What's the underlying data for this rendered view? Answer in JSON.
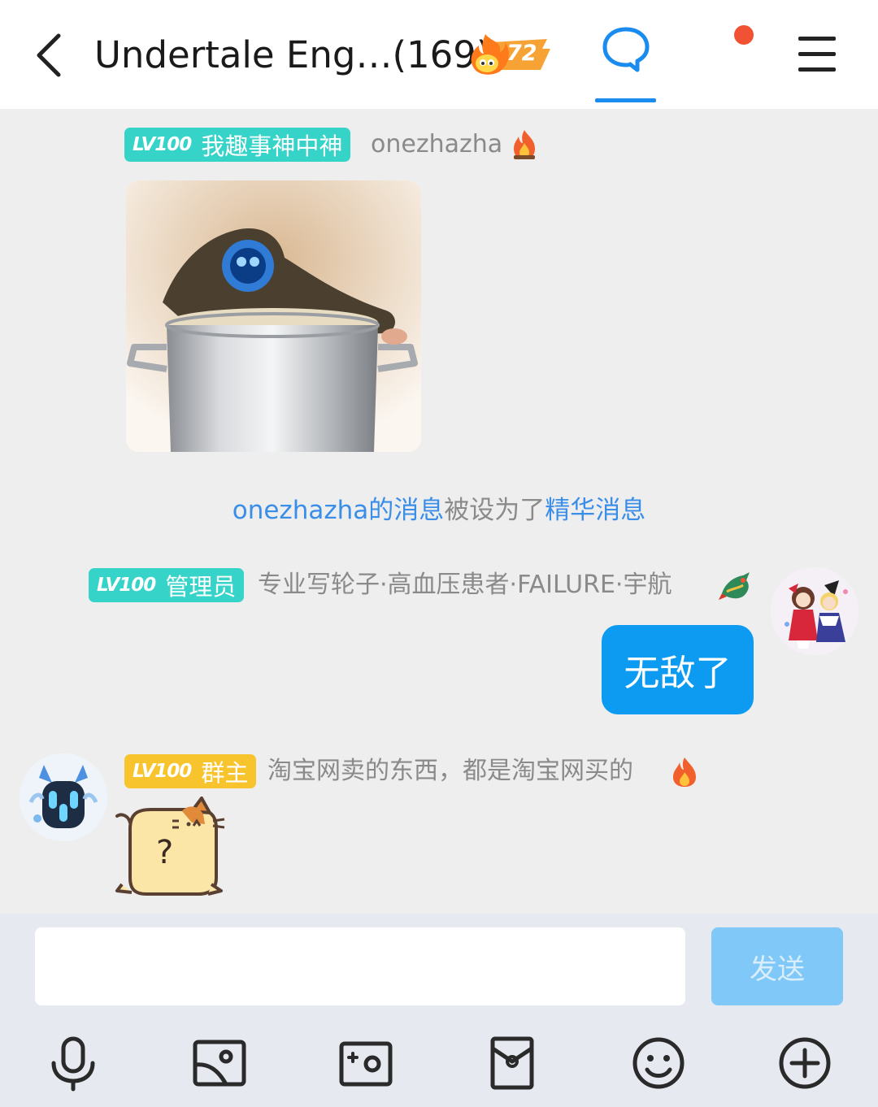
{
  "header": {
    "title": "Undertale Eng…(169)",
    "fire_level": "72"
  },
  "messages": {
    "first": {
      "level": "LV100",
      "title": "我趣事神中神",
      "nickname": "onezhazha"
    },
    "system_notice": {
      "sender_link": "onezhazha的消息",
      "middle": "被设为了",
      "feature_link": "精华消息"
    },
    "second": {
      "level": "LV100",
      "title": "管理员",
      "nickname": "专业写轮子·高血压患者·FAILURE·宇航",
      "text": "无敌了"
    },
    "third": {
      "level": "LV100",
      "title": "群主",
      "nickname": "淘宝网卖的东西，都是淘宝网买的",
      "sticker_text": "?"
    }
  },
  "composer": {
    "placeholder": "",
    "send_label": "发送"
  },
  "colors": {
    "accent": "#1a8cf0",
    "bubble": "#0d9bf2",
    "badge_green": "#35d3c8",
    "badge_gold": "#f8c42e",
    "notification": "#f25234"
  }
}
